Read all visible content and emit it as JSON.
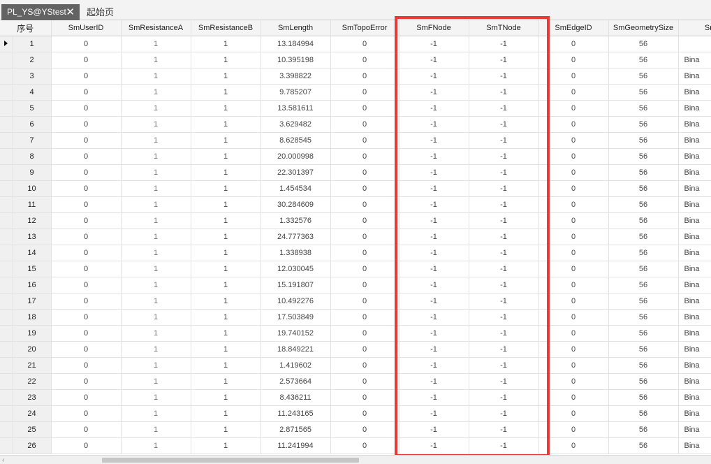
{
  "tabs": [
    {
      "label": "PL_YS@YStest",
      "close": "✕"
    },
    {
      "label": "起始页"
    }
  ],
  "columns": [
    "序号",
    "SmUserID",
    "SmResistanceA",
    "SmResistanceB",
    "SmLength",
    "SmTopoError",
    "SmFNode",
    "SmTNode",
    "SmEdgeID",
    "SmGeometrySize",
    "SmF"
  ],
  "rows": [
    {
      "idx": "1",
      "user": "0",
      "ra": "1",
      "rb": "1",
      "len": "13.184994",
      "topo": "0",
      "fn": "-1",
      "tn": "-1",
      "edge": "0",
      "size": "56",
      "geo": ""
    },
    {
      "idx": "2",
      "user": "0",
      "ra": "1",
      "rb": "1",
      "len": "10.395198",
      "topo": "0",
      "fn": "-1",
      "tn": "-1",
      "edge": "0",
      "size": "56",
      "geo": "Bina"
    },
    {
      "idx": "3",
      "user": "0",
      "ra": "1",
      "rb": "1",
      "len": "3.398822",
      "topo": "0",
      "fn": "-1",
      "tn": "-1",
      "edge": "0",
      "size": "56",
      "geo": "Bina"
    },
    {
      "idx": "4",
      "user": "0",
      "ra": "1",
      "rb": "1",
      "len": "9.785207",
      "topo": "0",
      "fn": "-1",
      "tn": "-1",
      "edge": "0",
      "size": "56",
      "geo": "Bina"
    },
    {
      "idx": "5",
      "user": "0",
      "ra": "1",
      "rb": "1",
      "len": "13.581611",
      "topo": "0",
      "fn": "-1",
      "tn": "-1",
      "edge": "0",
      "size": "56",
      "geo": "Bina"
    },
    {
      "idx": "6",
      "user": "0",
      "ra": "1",
      "rb": "1",
      "len": "3.629482",
      "topo": "0",
      "fn": "-1",
      "tn": "-1",
      "edge": "0",
      "size": "56",
      "geo": "Bina"
    },
    {
      "idx": "7",
      "user": "0",
      "ra": "1",
      "rb": "1",
      "len": "8.628545",
      "topo": "0",
      "fn": "-1",
      "tn": "-1",
      "edge": "0",
      "size": "56",
      "geo": "Bina"
    },
    {
      "idx": "8",
      "user": "0",
      "ra": "1",
      "rb": "1",
      "len": "20.000998",
      "topo": "0",
      "fn": "-1",
      "tn": "-1",
      "edge": "0",
      "size": "56",
      "geo": "Bina"
    },
    {
      "idx": "9",
      "user": "0",
      "ra": "1",
      "rb": "1",
      "len": "22.301397",
      "topo": "0",
      "fn": "-1",
      "tn": "-1",
      "edge": "0",
      "size": "56",
      "geo": "Bina"
    },
    {
      "idx": "10",
      "user": "0",
      "ra": "1",
      "rb": "1",
      "len": "1.454534",
      "topo": "0",
      "fn": "-1",
      "tn": "-1",
      "edge": "0",
      "size": "56",
      "geo": "Bina"
    },
    {
      "idx": "11",
      "user": "0",
      "ra": "1",
      "rb": "1",
      "len": "30.284609",
      "topo": "0",
      "fn": "-1",
      "tn": "-1",
      "edge": "0",
      "size": "56",
      "geo": "Bina"
    },
    {
      "idx": "12",
      "user": "0",
      "ra": "1",
      "rb": "1",
      "len": "1.332576",
      "topo": "0",
      "fn": "-1",
      "tn": "-1",
      "edge": "0",
      "size": "56",
      "geo": "Bina"
    },
    {
      "idx": "13",
      "user": "0",
      "ra": "1",
      "rb": "1",
      "len": "24.777363",
      "topo": "0",
      "fn": "-1",
      "tn": "-1",
      "edge": "0",
      "size": "56",
      "geo": "Bina"
    },
    {
      "idx": "14",
      "user": "0",
      "ra": "1",
      "rb": "1",
      "len": "1.338938",
      "topo": "0",
      "fn": "-1",
      "tn": "-1",
      "edge": "0",
      "size": "56",
      "geo": "Bina"
    },
    {
      "idx": "15",
      "user": "0",
      "ra": "1",
      "rb": "1",
      "len": "12.030045",
      "topo": "0",
      "fn": "-1",
      "tn": "-1",
      "edge": "0",
      "size": "56",
      "geo": "Bina"
    },
    {
      "idx": "16",
      "user": "0",
      "ra": "1",
      "rb": "1",
      "len": "15.191807",
      "topo": "0",
      "fn": "-1",
      "tn": "-1",
      "edge": "0",
      "size": "56",
      "geo": "Bina"
    },
    {
      "idx": "17",
      "user": "0",
      "ra": "1",
      "rb": "1",
      "len": "10.492276",
      "topo": "0",
      "fn": "-1",
      "tn": "-1",
      "edge": "0",
      "size": "56",
      "geo": "Bina"
    },
    {
      "idx": "18",
      "user": "0",
      "ra": "1",
      "rb": "1",
      "len": "17.503849",
      "topo": "0",
      "fn": "-1",
      "tn": "-1",
      "edge": "0",
      "size": "56",
      "geo": "Bina"
    },
    {
      "idx": "19",
      "user": "0",
      "ra": "1",
      "rb": "1",
      "len": "19.740152",
      "topo": "0",
      "fn": "-1",
      "tn": "-1",
      "edge": "0",
      "size": "56",
      "geo": "Bina"
    },
    {
      "idx": "20",
      "user": "0",
      "ra": "1",
      "rb": "1",
      "len": "18.849221",
      "topo": "0",
      "fn": "-1",
      "tn": "-1",
      "edge": "0",
      "size": "56",
      "geo": "Bina"
    },
    {
      "idx": "21",
      "user": "0",
      "ra": "1",
      "rb": "1",
      "len": "1.419602",
      "topo": "0",
      "fn": "-1",
      "tn": "-1",
      "edge": "0",
      "size": "56",
      "geo": "Bina"
    },
    {
      "idx": "22",
      "user": "0",
      "ra": "1",
      "rb": "1",
      "len": "2.573664",
      "topo": "0",
      "fn": "-1",
      "tn": "-1",
      "edge": "0",
      "size": "56",
      "geo": "Bina"
    },
    {
      "idx": "23",
      "user": "0",
      "ra": "1",
      "rb": "1",
      "len": "8.436211",
      "topo": "0",
      "fn": "-1",
      "tn": "-1",
      "edge": "0",
      "size": "56",
      "geo": "Bina"
    },
    {
      "idx": "24",
      "user": "0",
      "ra": "1",
      "rb": "1",
      "len": "11.243165",
      "topo": "0",
      "fn": "-1",
      "tn": "-1",
      "edge": "0",
      "size": "56",
      "geo": "Bina"
    },
    {
      "idx": "25",
      "user": "0",
      "ra": "1",
      "rb": "1",
      "len": "2.871565",
      "topo": "0",
      "fn": "-1",
      "tn": "-1",
      "edge": "0",
      "size": "56",
      "geo": "Bina"
    },
    {
      "idx": "26",
      "user": "0",
      "ra": "1",
      "rb": "1",
      "len": "11.241994",
      "topo": "0",
      "fn": "-1",
      "tn": "-1",
      "edge": "0",
      "size": "56",
      "geo": "Bina"
    }
  ],
  "highlight_color": "#e83a3a",
  "active_tab_color": "#636363"
}
